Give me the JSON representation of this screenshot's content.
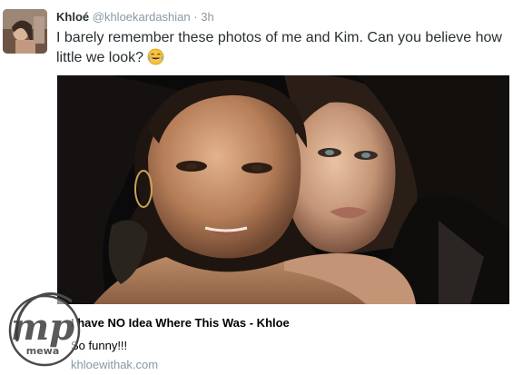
{
  "tweet": {
    "author_name": "Khloé",
    "author_handle": "@khloekardashian",
    "separator": "·",
    "timestamp": "3h",
    "text": "I barely remember these photos of me and Kim. Can you believe how little we look?",
    "emoji": "face-with-tears-of-joy"
  },
  "card": {
    "title": "I have NO Idea Where This Was - Khloe",
    "description": "So funny!!!",
    "domain": "khloewithak.com"
  },
  "watermark": {
    "text": "mp",
    "subtext": "mewa"
  },
  "colors": {
    "text": "#292f33",
    "muted": "#8899a6",
    "photo_bg": "#0b0a0a"
  }
}
